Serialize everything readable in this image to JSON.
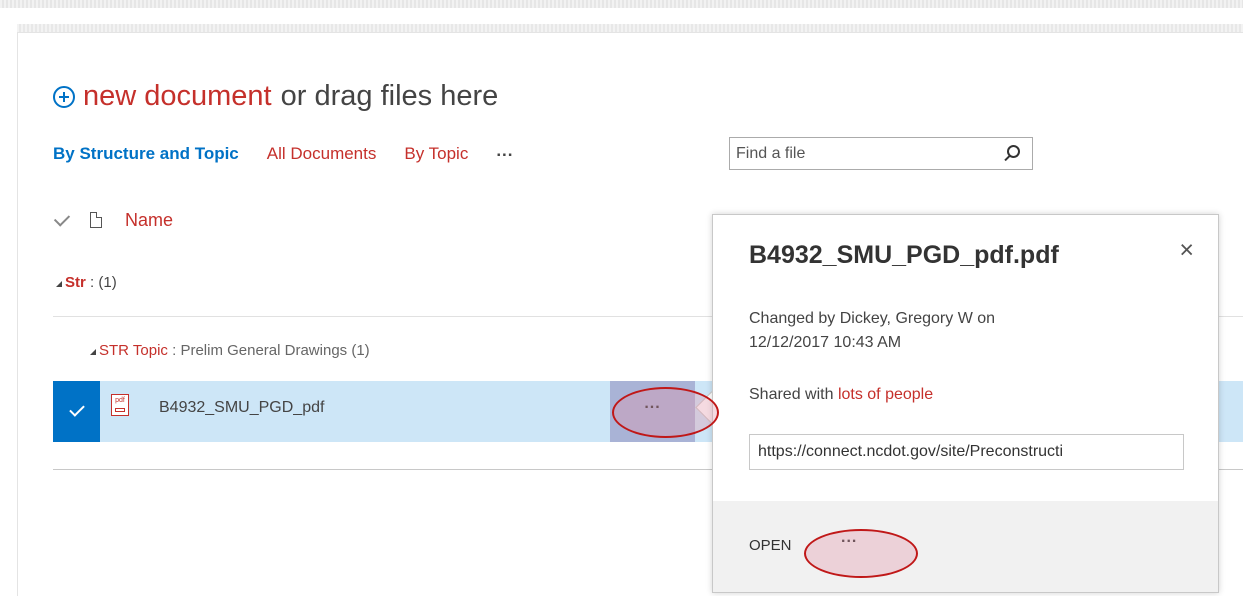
{
  "toolbar": {
    "new_document_label": "new document",
    "drag_text": "or drag files here"
  },
  "views": {
    "active": "By Structure and Topic",
    "items": [
      "All Documents",
      "By Topic"
    ],
    "more": "..."
  },
  "search": {
    "placeholder": "Find a file",
    "value": ""
  },
  "columns": {
    "name": "Name"
  },
  "groups": [
    {
      "label": "Str",
      "separator": " : ",
      "count": "(1)"
    },
    {
      "label": "STR Topic",
      "separator": " : ",
      "value": "Prelim General Drawings",
      "count": "(1)"
    }
  ],
  "file": {
    "icon_text": "pdf",
    "name": "B4932_SMU_PGD_pdf",
    "ellipsis": "..."
  },
  "callout": {
    "title": "B4932_SMU_PGD_pdf.pdf",
    "close": "×",
    "changed": "Changed by Dickey, Gregory W on 12/12/2017 10:43 AM",
    "shared_prefix": "Shared with ",
    "shared_link": "lots of people",
    "url": "https://connect.ncdot.gov/site/Preconstructi",
    "open_label": "OPEN",
    "more": "..."
  },
  "colors": {
    "link_red": "#c5302b",
    "accent_blue": "#0072c6",
    "selected_row": "#cde6f7",
    "highlight_ring": "#c01818"
  }
}
